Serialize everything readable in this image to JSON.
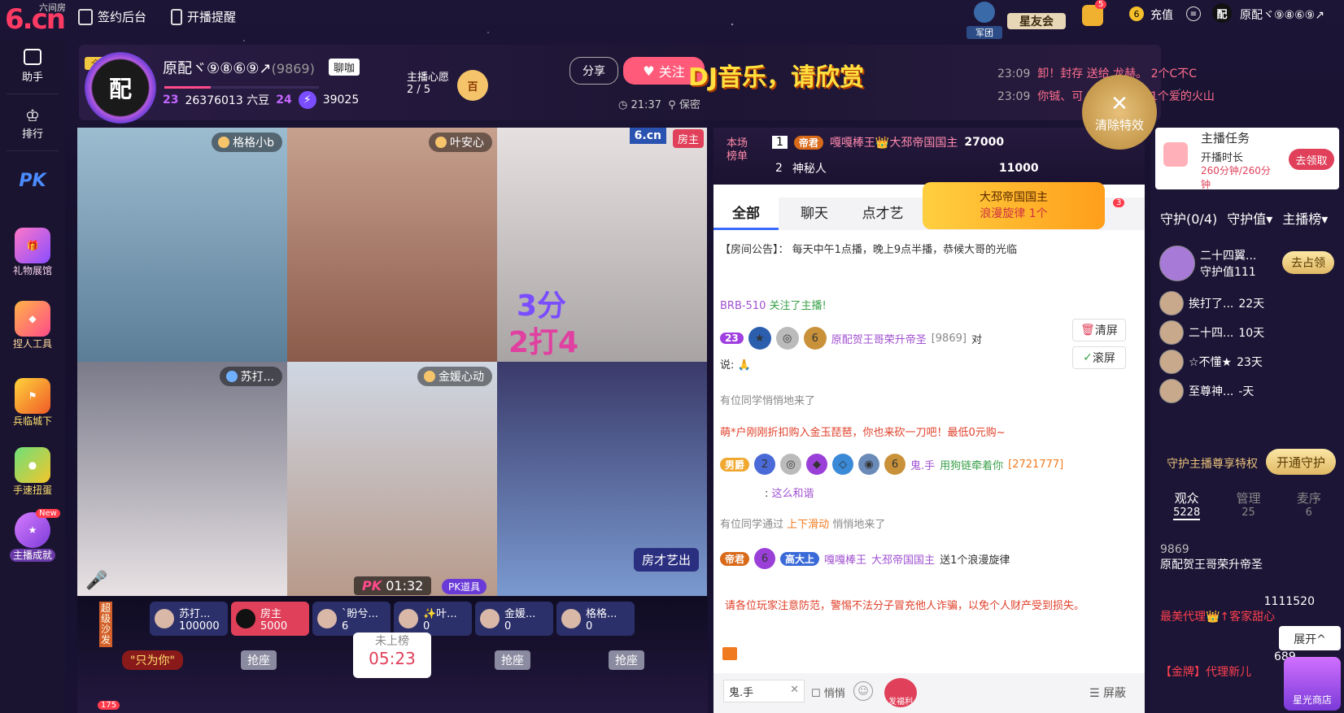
{
  "topbar": {
    "logo": "6.cn",
    "logo_sub": "六间房",
    "sign_backend": "签约后台",
    "live_reminder": "开播提醒",
    "army": "军团",
    "star_club": "星友会",
    "bag_count": "5",
    "recharge": "充值",
    "user_name": "原配ヾ⑨⑧⑥⑨↗"
  },
  "leftrail": {
    "assistant": "助手",
    "ranking": "排行",
    "pk": "PK",
    "gift_hall": "礼物展馆",
    "tools": "捏人工具",
    "game": "兵临城下",
    "game2": "手速扭蛋",
    "achievement": "主播成就",
    "new_badge": "New"
  },
  "anchor": {
    "name": "原配ヾ⑨⑧⑥⑨↗",
    "id": "(9869)",
    "chat_btn": "聊咖",
    "level1": "23",
    "beans": "26376013 六豆",
    "level2": "24",
    "energy": "39025",
    "wish_label": "主播心愿",
    "wish_progress": "2 / 5",
    "wish_badge": "百",
    "share": "分享",
    "follow": "关注",
    "time": "21:37",
    "location": "保密",
    "banner_text": "DJ音乐，请欣赏",
    "top_tag": "全"
  },
  "marquee": [
    {
      "time": "23:09",
      "text": "卸！封存 送给 龙赫。 2个C不C"
    },
    {
      "time": "23:09",
      "text": "你铖、可 ... 安静唱歌 1个爱的火山"
    }
  ],
  "clear_effect": "清除特效",
  "streams": [
    {
      "name": "格格小b"
    },
    {
      "name": "叶安心"
    },
    {
      "name": "房主",
      "tag": "6.cn"
    },
    {
      "name": "苏打..."
    },
    {
      "name": "金媛心动"
    },
    {
      "name": "房才艺出"
    }
  ],
  "overlay": {
    "score1": "3分",
    "score2": "2打4"
  },
  "timer": "01:32",
  "pk_tool": "PK道具",
  "seats": [
    {
      "name": "苏打...",
      "value": "100000"
    },
    {
      "name": "房主",
      "value": "5000"
    },
    {
      "name": "`盼兮...",
      "value": "6"
    },
    {
      "name": "✨叶...",
      "value": "0"
    },
    {
      "name": "金媛...",
      "value": "0"
    },
    {
      "name": "格格...",
      "value": "0"
    }
  ],
  "seat_tag": "超级沙发",
  "only_you": "\"只为你\"",
  "grab": "抢座",
  "not_ranked": "未上榜",
  "countdown": "05:23",
  "online": "175",
  "rank": {
    "label": "本场榜单",
    "rows": [
      {
        "pos": "1",
        "badge": "帝君",
        "name": "嘎嘎棒王👑大邳帝国国主",
        "score": "27000"
      },
      {
        "pos": "2",
        "badge": "",
        "name": "神秘人",
        "score": "11000"
      }
    ]
  },
  "gift_popup": {
    "title": "大邳帝国国主",
    "item": "浪漫旋律 1个",
    "count": "3"
  },
  "chat_tabs": {
    "all": "全部",
    "chat": "聊天",
    "vote": "点才艺"
  },
  "announcement": "【房间公告】：  每天中午1点播，晚上9点半播，恭候大哥的光临",
  "chat": {
    "follow_user": "BRB-510",
    "follow_text": "关注了主播!",
    "msg1_name": "原配贺王哥荣升帝圣",
    "msg1_id": "[9869]",
    "msg1_to": "对",
    "msg1_say": "说:",
    "enter1": "有位同学悄悄地来了",
    "promo": "萌*户刚刚折扣购入金玉琵琶，你也来砍一刀吧！最低0元购~",
    "msg2_badge": "男爵",
    "msg2_name": "鬼.手",
    "msg2_text": "用狗链牵着你",
    "msg2_id": "[2721777]",
    "msg2_say": "这么和谐",
    "enter2_pre": "有位同学通过",
    "enter2_link": "上下滑动",
    "enter2_post": "悄悄地来了",
    "gift_badge": "帝君",
    "gift_lvl": "高大上",
    "gift_from": "嘎嘎棒王",
    "gift_to": "大邳帝国国主",
    "gift_text": "送1个浪漫旋律",
    "warning": "请各位玩家注意防范，警惕不法分子冒充他人诈骗，以免个人财产受到损失。",
    "clear": "清屏",
    "scroll": "滚屏",
    "input_value": "鬼.手",
    "whisper": "悄悄",
    "shield": "屏蔽",
    "gift_btn": "发福利"
  },
  "task": {
    "title": "主播任务",
    "duration_label": "开播时长",
    "progress": "260分钟/260分钟",
    "claim": "去领取"
  },
  "guard": {
    "tab1": "守护(0/4)",
    "tab2": "守护值▾",
    "tab3": "主播榜▾",
    "top_name": "二十四翼...",
    "top_value": "守护值111",
    "occupy": "去占领",
    "rows": [
      {
        "name": "挨打了...",
        "days": "22天"
      },
      {
        "name": "二十四...",
        "days": "10天"
      },
      {
        "name": "☆不懂★",
        "days": "23天"
      },
      {
        "name": "至尊神...",
        "days": "-天"
      }
    ],
    "privilege": "守护主播尊享特权",
    "open": "开通守护"
  },
  "audience": {
    "label": "观众",
    "count": "5228",
    "admin": "管理",
    "admin_count": "25",
    "mic": "麦序",
    "mic_count": "6",
    "u1_id": "9869",
    "u1_name": "原配贺王哥荣升帝圣",
    "u2_id": "1111520",
    "u2_name": "最美代理👑↑客家甜心",
    "u3_id": "689",
    "u3_name": "【金牌】代理新儿",
    "expand": "展开^",
    "shop": "星光商店"
  }
}
